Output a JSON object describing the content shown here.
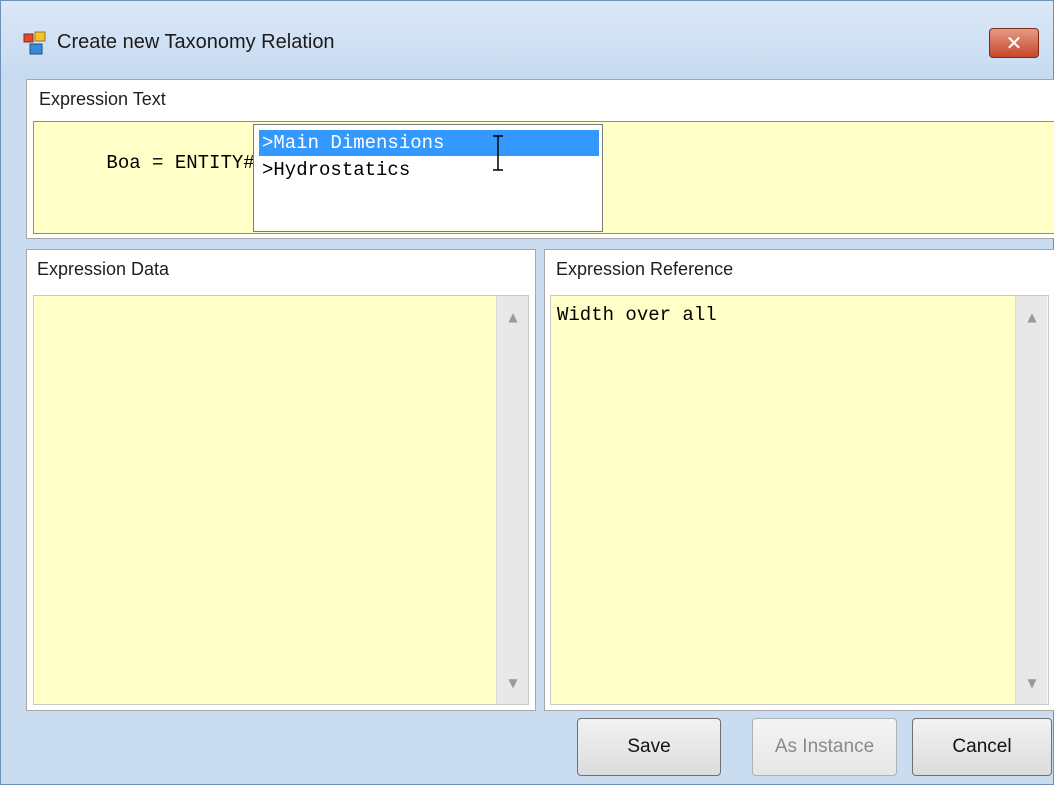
{
  "window": {
    "title": "Create new Taxonomy Relation",
    "close_label": "✕"
  },
  "expression_text": {
    "label": "Expression Text",
    "value": "Boa = ENTITY#",
    "open_paren": "(",
    "paren_color": "#ff3300",
    "suggestions": [
      {
        "label": ">Main Dimensions",
        "selected": true
      },
      {
        "label": ">Hydrostatics",
        "selected": false
      }
    ]
  },
  "expression_data": {
    "label": "Expression Data",
    "value": ""
  },
  "expression_reference": {
    "label": "Expression Reference",
    "value": "Width over all"
  },
  "buttons": {
    "save": "Save",
    "as_instance": "As Instance",
    "cancel": "Cancel"
  },
  "icons": {
    "window": "application-icon",
    "scroll_up": "scroll-up-icon",
    "scroll_down": "scroll-down-icon",
    "cursor": "text-cursor-icon"
  },
  "colors": {
    "field_background": "#ffffc8",
    "selection": "#3399ff",
    "window_chrome": "#c9dcf0"
  }
}
